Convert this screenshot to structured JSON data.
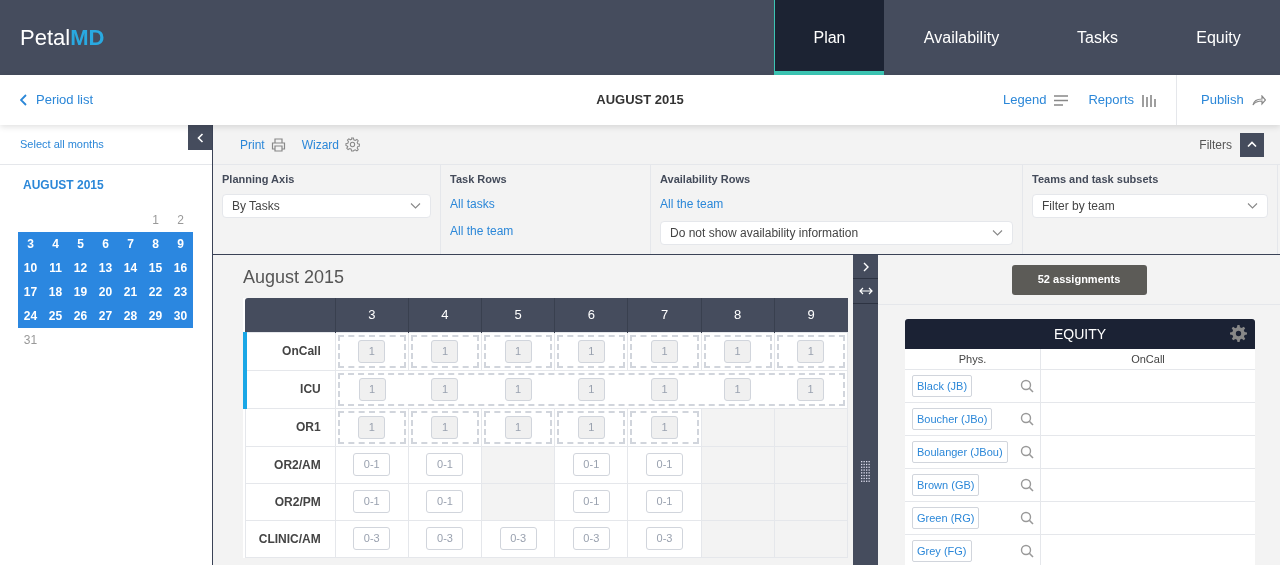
{
  "logo": {
    "first": "Petal",
    "second": "MD"
  },
  "nav": [
    {
      "label": "Plan",
      "selected": true
    },
    {
      "label": "Availability",
      "selected": false
    },
    {
      "label": "Tasks",
      "selected": false
    },
    {
      "label": "Equity",
      "selected": false
    }
  ],
  "subheader": {
    "back": "Period list",
    "title": "AUGUST 2015",
    "legend": "Legend",
    "reports": "Reports",
    "publish": "Publish"
  },
  "sidebar": {
    "select_all": "Select all months",
    "month": "AUGUST 2015",
    "weeks": [
      [
        {
          "day": "1",
          "selected": false
        },
        {
          "day": "2",
          "selected": false
        }
      ],
      [
        {
          "day": "3",
          "selected": true
        },
        {
          "day": "4",
          "selected": true
        },
        {
          "day": "5",
          "selected": true
        },
        {
          "day": "6",
          "selected": true
        },
        {
          "day": "7",
          "selected": true
        },
        {
          "day": "8",
          "selected": true
        },
        {
          "day": "9",
          "selected": true
        }
      ],
      [
        {
          "day": "10",
          "selected": true
        },
        {
          "day": "11",
          "selected": true
        },
        {
          "day": "12",
          "selected": true
        },
        {
          "day": "13",
          "selected": true
        },
        {
          "day": "14",
          "selected": true
        },
        {
          "day": "15",
          "selected": true
        },
        {
          "day": "16",
          "selected": true
        }
      ],
      [
        {
          "day": "17",
          "selected": true
        },
        {
          "day": "18",
          "selected": true
        },
        {
          "day": "19",
          "selected": true
        },
        {
          "day": "20",
          "selected": true
        },
        {
          "day": "21",
          "selected": true
        },
        {
          "day": "22",
          "selected": true
        },
        {
          "day": "23",
          "selected": true
        }
      ],
      [
        {
          "day": "24",
          "selected": true
        },
        {
          "day": "25",
          "selected": true
        },
        {
          "day": "26",
          "selected": true
        },
        {
          "day": "27",
          "selected": true
        },
        {
          "day": "28",
          "selected": true
        },
        {
          "day": "29",
          "selected": true
        },
        {
          "day": "30",
          "selected": true
        }
      ],
      [
        {
          "day": "31",
          "selected": false
        }
      ]
    ]
  },
  "toolbar": {
    "print": "Print",
    "wizard": "Wizard",
    "filters": "Filters"
  },
  "filters": [
    {
      "label": "Planning Axis",
      "items": [
        {
          "kind": "select",
          "text": "By Tasks"
        }
      ]
    },
    {
      "label": "Task Rows",
      "items": [
        {
          "kind": "link",
          "text": "All tasks"
        },
        {
          "kind": "link",
          "text": "All the team"
        }
      ]
    },
    {
      "label": "Availability Rows",
      "items": [
        {
          "kind": "link",
          "text": "All the team"
        },
        {
          "kind": "select",
          "text": "Do not show availability information"
        }
      ]
    },
    {
      "label": "Teams and task subsets",
      "items": [
        {
          "kind": "select",
          "text": "Filter by team"
        }
      ]
    }
  ],
  "schedule": {
    "title": "August 2015",
    "columns": [
      "3",
      "4",
      "5",
      "6",
      "7",
      "8",
      "9"
    ],
    "rows": [
      {
        "label": "OnCall",
        "flagged": true,
        "kind": "dashed",
        "cells": [
          {
            "kind": "slot",
            "value": "1"
          },
          {
            "kind": "slot",
            "value": "1"
          },
          {
            "kind": "slot",
            "value": "1"
          },
          {
            "kind": "slot",
            "value": "1"
          },
          {
            "kind": "slot",
            "value": "1"
          },
          {
            "kind": "slot",
            "value": "1"
          },
          {
            "kind": "slot",
            "value": "1"
          }
        ]
      },
      {
        "label": "ICU",
        "flagged": true,
        "kind": "spanned",
        "cells": [
          {
            "kind": "slot",
            "value": "1"
          },
          {
            "kind": "slot",
            "value": "1"
          },
          {
            "kind": "slot",
            "value": "1"
          },
          {
            "kind": "slot",
            "value": "1"
          },
          {
            "kind": "slot",
            "value": "1"
          },
          {
            "kind": "slot",
            "value": "1"
          },
          {
            "kind": "slot",
            "value": "1"
          }
        ]
      },
      {
        "label": "OR1",
        "flagged": false,
        "kind": "dashed",
        "cells": [
          {
            "kind": "slot",
            "value": "1"
          },
          {
            "kind": "slot",
            "value": "1"
          },
          {
            "kind": "slot",
            "value": "1"
          },
          {
            "kind": "slot",
            "value": "1"
          },
          {
            "kind": "slot",
            "value": "1"
          },
          {
            "kind": "blocked"
          },
          {
            "kind": "blocked"
          }
        ]
      },
      {
        "label": "OR2/AM",
        "flagged": false,
        "kind": "plain",
        "cells": [
          {
            "kind": "slot",
            "value": "0-1"
          },
          {
            "kind": "slot",
            "value": "0-1"
          },
          {
            "kind": "blocked"
          },
          {
            "kind": "slot",
            "value": "0-1"
          },
          {
            "kind": "slot",
            "value": "0-1"
          },
          {
            "kind": "blocked"
          },
          {
            "kind": "blocked"
          }
        ]
      },
      {
        "label": "OR2/PM",
        "flagged": false,
        "kind": "plain",
        "cells": [
          {
            "kind": "slot",
            "value": "0-1"
          },
          {
            "kind": "slot",
            "value": "0-1"
          },
          {
            "kind": "blocked"
          },
          {
            "kind": "slot",
            "value": "0-1"
          },
          {
            "kind": "slot",
            "value": "0-1"
          },
          {
            "kind": "blocked"
          },
          {
            "kind": "blocked"
          }
        ]
      },
      {
        "label": "CLINIC/AM",
        "flagged": false,
        "kind": "plain",
        "cells": [
          {
            "kind": "slot",
            "value": "0-3"
          },
          {
            "kind": "slot",
            "value": "0-3"
          },
          {
            "kind": "slot",
            "value": "0-3"
          },
          {
            "kind": "slot",
            "value": "0-3"
          },
          {
            "kind": "slot",
            "value": "0-3"
          },
          {
            "kind": "blocked"
          },
          {
            "kind": "blocked"
          }
        ]
      }
    ]
  },
  "assignments": "52 assignments",
  "equity": {
    "title": "EQUITY",
    "columns": [
      "Phys.",
      "OnCall"
    ],
    "physicians": [
      "Black (JB)",
      "Boucher (JBo)",
      "Boulanger (JBou)",
      "Brown (GB)",
      "Green (RG)",
      "Grey (FG)"
    ]
  }
}
